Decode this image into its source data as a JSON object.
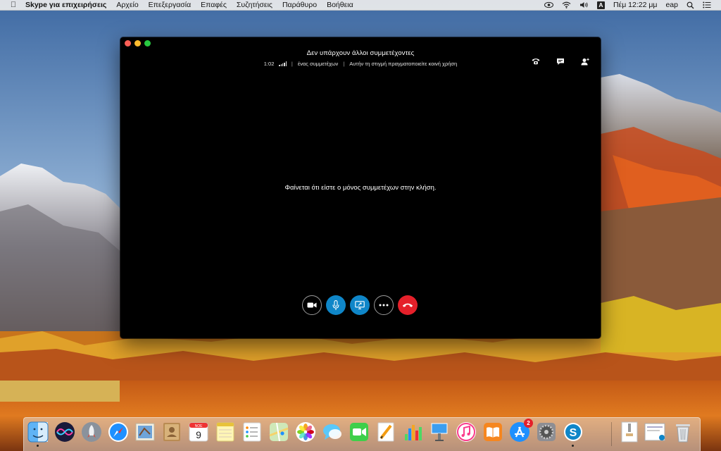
{
  "menubar": {
    "app_name": "Skype για επιχειρήσεις",
    "menus": [
      "Αρχείο",
      "Επεξεργασία",
      "Επαφές",
      "Συζητήσεις",
      "Παράθυρο",
      "Βοήθεια"
    ],
    "input_source": "A",
    "clock": "Πέμ 12:22 μμ",
    "user": "eap"
  },
  "call": {
    "title": "Δεν υπάρχουν άλλοι συμμετέχοντες",
    "duration": "1:02",
    "participants": "ένας συμμετέχων",
    "sharing_status": "Αυτήν τη στιγμή πραγματοποιείτε κοινή χρήση",
    "center_message": "Φαίνεται ότι είστε ο μόνος συμμετέχων στην κλήση."
  },
  "dock": {
    "calendar_month": "ΝΟΕ",
    "calendar_day": "9",
    "appstore_badge": "2"
  },
  "colors": {
    "accent_blue": "#0f86c8",
    "hangup_red": "#e5202a",
    "window_bg": "#000000"
  }
}
